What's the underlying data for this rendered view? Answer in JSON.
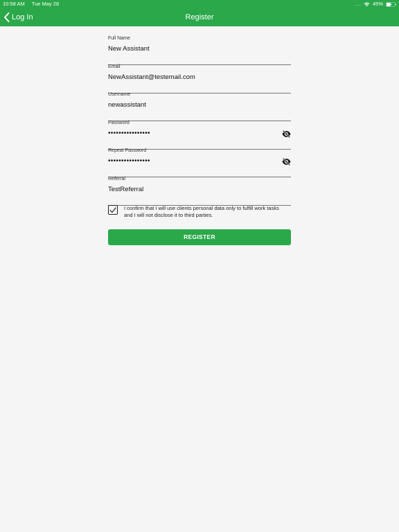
{
  "status_bar": {
    "time": "10:58 AM",
    "date": "Tue May 28",
    "signal": "....",
    "battery": "45%"
  },
  "navbar": {
    "back_label": "Log In",
    "title": "Register"
  },
  "form": {
    "full_name": {
      "label": "Full Name",
      "value": "New Assistant"
    },
    "email": {
      "label": "Email",
      "value": "NewAssistant@testemail.com"
    },
    "username": {
      "label": "Username",
      "value": "newassistant"
    },
    "password": {
      "label": "Password",
      "value": "••••••••••••••••"
    },
    "repeat_password": {
      "label": "Repeat Password",
      "value": "••••••••••••••••"
    },
    "referral": {
      "label": "Referral",
      "value": "TestReferral"
    }
  },
  "consent": {
    "checked": true,
    "text": "I confirm that I will use clients personal data only to fulfill work tasks and I will not disclose it to third parties."
  },
  "register_button": {
    "label": "REGISTER"
  },
  "colors": {
    "brand_green": "#2aa84a",
    "background": "#f5f5f5"
  }
}
